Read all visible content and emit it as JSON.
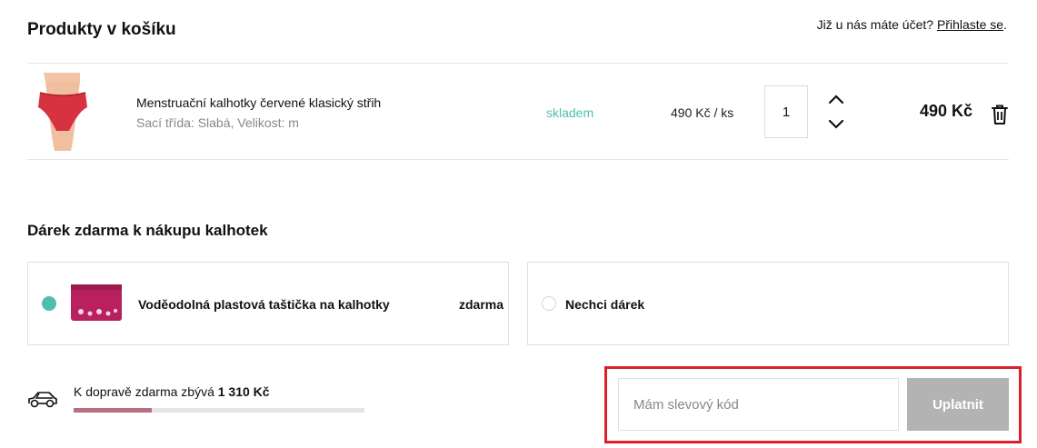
{
  "header": {
    "title": "Produkty v košíku",
    "login_prompt": "Již u nás máte účet?",
    "login_link": "Přihlaste se",
    "login_suffix": "."
  },
  "cart": {
    "items": [
      {
        "name": "Menstruační kalhotky červené klasický střih",
        "attributes": "Sací třída: Slabá, Velikost: m",
        "stock": "skladem",
        "unit_price": "490 Kč / ks",
        "quantity": "1",
        "total": "490 Kč",
        "product_color": "#d6323f"
      }
    ]
  },
  "gift": {
    "title": "Dárek zdarma k nákupu kalhotek",
    "options": [
      {
        "name": "Voděodolná plastová taštička na kalhotky",
        "price": "zdarma",
        "selected": true
      },
      {
        "name": "Nechci dárek",
        "selected": false
      }
    ]
  },
  "shipping": {
    "text": "K dopravě zdarma zbývá",
    "remaining": "1 310 Kč",
    "progress": 0.27
  },
  "discount": {
    "placeholder": "Mám slevový kód",
    "value": "",
    "apply_label": "Uplatnit"
  },
  "colors": {
    "accent": "#4fbfac",
    "progress": "#b96e80",
    "highlight_frame": "#d9202b",
    "button_disabled": "#b3b3b3"
  },
  "icons": [
    "chevron-up-icon",
    "chevron-down-icon",
    "trash-icon",
    "car-icon"
  ]
}
